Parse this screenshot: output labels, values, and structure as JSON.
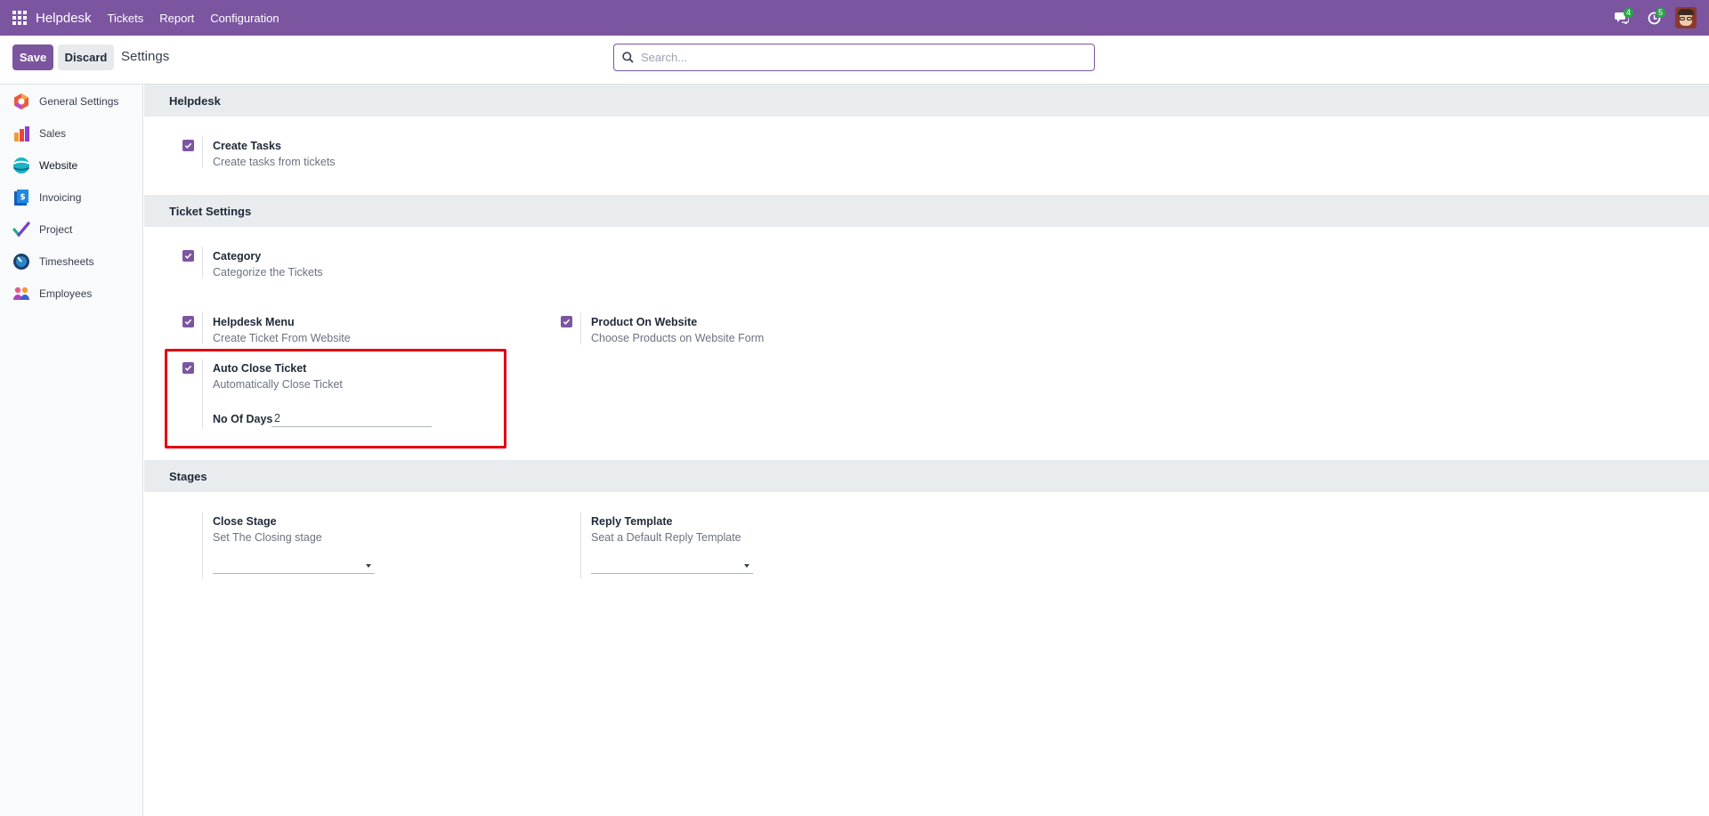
{
  "navbar": {
    "brand": "Helpdesk",
    "menu": [
      "Tickets",
      "Report",
      "Configuration"
    ],
    "messages_badge": "4",
    "activities_badge": "5",
    "color": "#7c55a0"
  },
  "control_panel": {
    "save_label": "Save",
    "discard_label": "Discard",
    "title": "Settings",
    "search_placeholder": "Search..."
  },
  "sidebar": {
    "items": [
      {
        "label": "General Settings",
        "icon": "general-settings-icon"
      },
      {
        "label": "Sales",
        "icon": "sales-icon"
      },
      {
        "label": "Website",
        "icon": "website-icon"
      },
      {
        "label": "Invoicing",
        "icon": "invoicing-icon"
      },
      {
        "label": "Project",
        "icon": "project-icon"
      },
      {
        "label": "Timesheets",
        "icon": "timesheets-icon"
      },
      {
        "label": "Employees",
        "icon": "employees-icon"
      }
    ],
    "active": "Website"
  },
  "sections": {
    "helpdesk": {
      "title": "Helpdesk",
      "create_tasks": {
        "title": "Create Tasks",
        "desc": "Create tasks from tickets",
        "checked": true
      }
    },
    "ticket_settings": {
      "title": "Ticket Settings",
      "category": {
        "title": "Category",
        "desc": "Categorize the Tickets",
        "checked": true
      },
      "helpdesk_menu": {
        "title": "Helpdesk Menu",
        "desc": "Create Ticket From Website",
        "checked": true
      },
      "product_on_website": {
        "title": "Product On Website",
        "desc": "Choose Products on Website Form",
        "checked": true
      },
      "auto_close": {
        "title": "Auto Close Ticket",
        "desc": "Automatically Close Ticket",
        "checked": true,
        "days_label": "No Of Days",
        "days_value": "2"
      }
    },
    "stages": {
      "title": "Stages",
      "close_stage": {
        "title": "Close Stage",
        "desc": "Set The Closing stage",
        "value": ""
      },
      "reply_template": {
        "title": "Reply Template",
        "desc": "Seat a Default Reply Template",
        "value": ""
      }
    }
  },
  "highlight_color": "#e3000f"
}
